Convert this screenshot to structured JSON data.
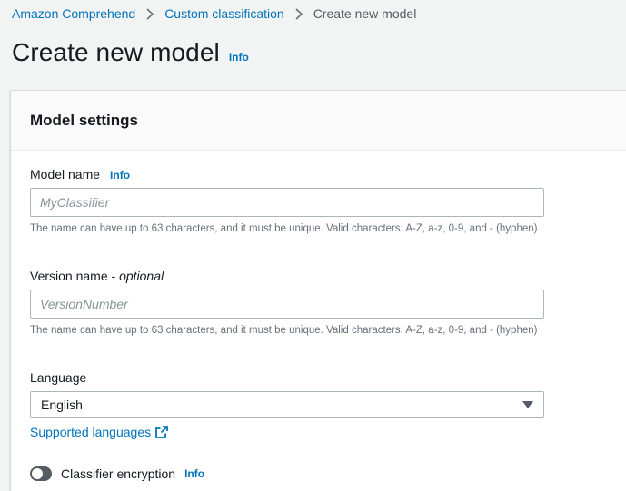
{
  "breadcrumb": {
    "items": [
      "Amazon Comprehend",
      "Custom classification"
    ],
    "current": "Create new model"
  },
  "page": {
    "title": "Create new model",
    "info": "Info"
  },
  "panel": {
    "title": "Model settings"
  },
  "model_name": {
    "label": "Model name",
    "info": "Info",
    "placeholder": "MyClassifier",
    "value": "",
    "hint": "The name can have up to 63 characters, and it must be unique. Valid characters: A-Z, a-z, 0-9, and - (hyphen)"
  },
  "version_name": {
    "label": "Version name - ",
    "optional": "optional",
    "placeholder": "VersionNumber",
    "value": "",
    "hint": "The name can have up to 63 characters, and it must be unique. Valid characters: A-Z, a-z, 0-9, and - (hyphen)"
  },
  "language": {
    "label": "Language",
    "selected": "English",
    "supported_link": "Supported languages"
  },
  "encryption": {
    "label": "Classifier encryption",
    "info": "Info",
    "enabled": false
  },
  "icons": {
    "breadcrumb_separator": "chevron-right-icon",
    "dropdown": "caret-down-icon",
    "external_link": "external-link-icon"
  },
  "colors": {
    "link": "#0073bb",
    "background": "#f2f3f3"
  }
}
